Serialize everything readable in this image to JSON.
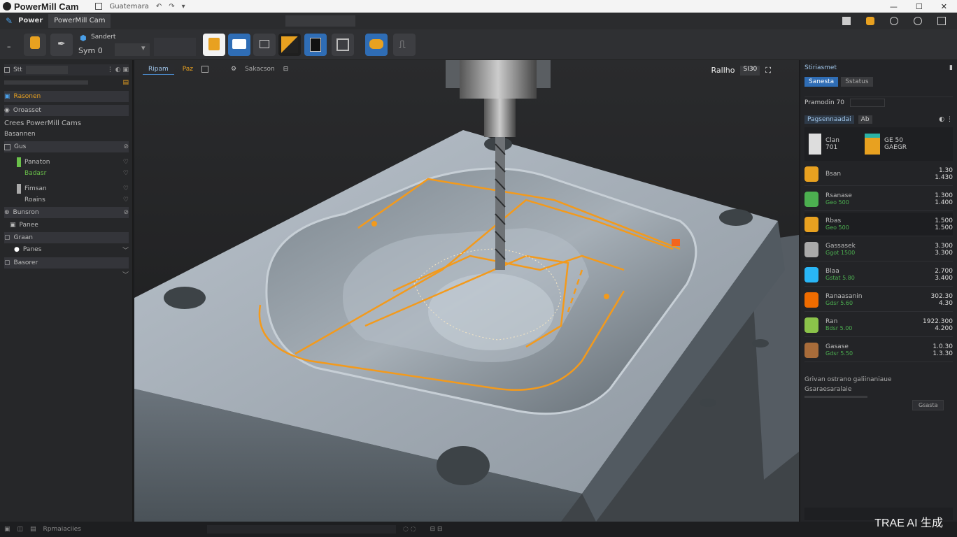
{
  "window": {
    "title": "PowerMill Cam",
    "quick_access": "Guatemara",
    "controls": [
      "—",
      "☐",
      "✕"
    ]
  },
  "menu": {
    "tabs": [
      "Power",
      "PowerMill Cam"
    ],
    "active": 1
  },
  "ribbon": {
    "label1": "Sandert",
    "label2": "Sym 0"
  },
  "left_panel": {
    "search_label": "Stt",
    "items": [
      {
        "label": "Rasonen",
        "icon": "folder"
      },
      {
        "label": "Oroasset",
        "icon": "folder"
      },
      {
        "label": "Crees PowerMill Cams",
        "icon": "none"
      },
      {
        "label": "Basannen",
        "icon": "none"
      },
      {
        "label": "Gus",
        "icon": "folder"
      },
      {
        "label": "Panaton",
        "icon": "tool"
      },
      {
        "label": "Badasr",
        "icon": "tool"
      },
      {
        "label": "Fimsan",
        "icon": "tool"
      },
      {
        "label": "Roains",
        "icon": "tool"
      },
      {
        "label": "Bunsron",
        "icon": "folder"
      },
      {
        "label": "Panee",
        "icon": "folder"
      },
      {
        "label": "Graan",
        "icon": "folder"
      },
      {
        "label": "Panes",
        "icon": "folder"
      },
      {
        "label": "Basorer",
        "icon": "folder"
      }
    ]
  },
  "viewport": {
    "tab1": "Ripam",
    "tab2": "Paz",
    "tab3": "Sakacson",
    "controls_label": "Rallho",
    "zoom_label": "SI30"
  },
  "right_panel": {
    "header": "Stiriasmet",
    "btn_active": "Sanesta",
    "btn_inactive": "Sstatus",
    "field_label": "Pramodin 70",
    "subtab": "Pagsennaadai",
    "subtab_count": "Ab",
    "featured": {
      "a_label": "Clan",
      "a_val": "701",
      "b_label": "GE 50",
      "b_val": "GAEGR"
    },
    "tools": [
      {
        "name": "Bsan",
        "sub": "",
        "val1": "1.30",
        "val2": "1.430",
        "color": "#e8a120"
      },
      {
        "name": "Rsanase",
        "sub": "Geo 500",
        "val1": "1.300",
        "val2": "1.400",
        "color": "#4caf50"
      },
      {
        "name": "Rbas",
        "sub": "Geo 500",
        "val1": "1.500",
        "val2": "1.500",
        "color": "#e8a120"
      },
      {
        "name": "Gassasek",
        "sub": "Ggot 1500",
        "val1": "3.300",
        "val2": "3.300",
        "color": "#aaaaaa"
      },
      {
        "name": "Blaa",
        "sub": "Gstat 5.80",
        "val1": "2.700",
        "val2": "3.400",
        "color": "#29b6f6"
      },
      {
        "name": "Ranaasanin",
        "sub": "Gdsr 5.60",
        "val1": "302.30",
        "val2": "4.30",
        "color": "#ef6c00"
      },
      {
        "name": "Ran",
        "sub": "Bdsr 5.00",
        "val1": "1922.300",
        "val2": "4.200",
        "color": "#8bc34a"
      },
      {
        "name": "Gasase",
        "sub": "Gdsr 5.50",
        "val1": "1.0.30",
        "val2": "1.3.30",
        "color": "#a86c3a"
      }
    ],
    "footer1": "Grivan ostrano galiinaniaue",
    "footer2": "Gsaraesaralaie",
    "footer_btn": "Gsasta"
  },
  "statusbar": {
    "label": "Rpmaiaciies"
  },
  "watermark": "TRAE AI 生成",
  "colors": {
    "toolpath": "#f39a1c",
    "part": "#9aa3ab",
    "accent": "#4a86c5"
  }
}
